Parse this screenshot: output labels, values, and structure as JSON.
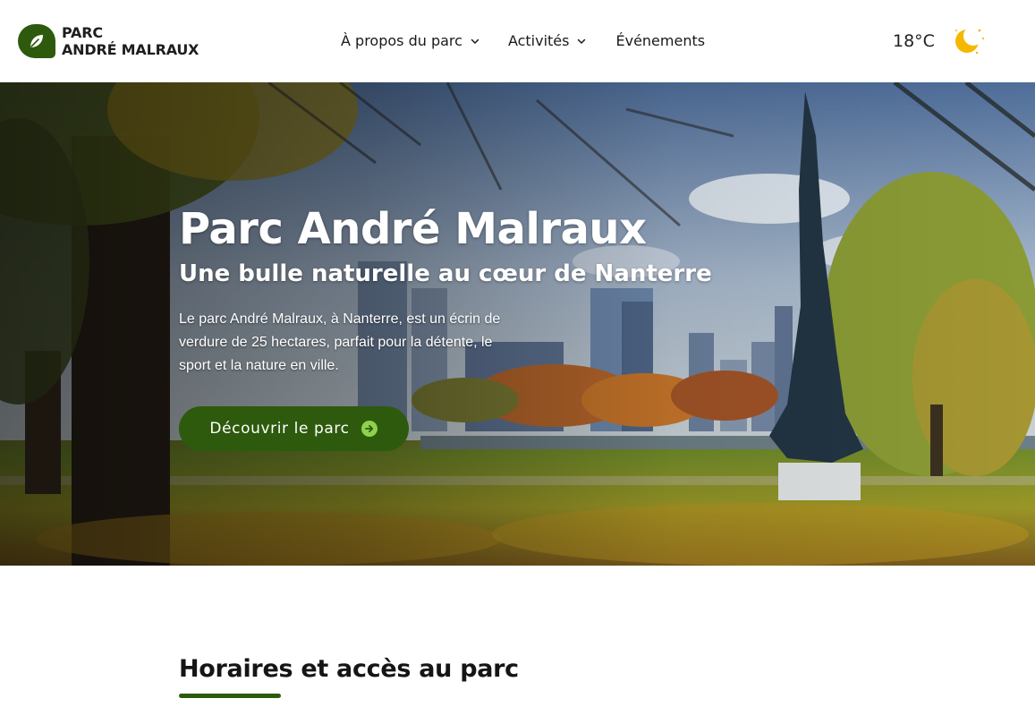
{
  "brand": {
    "line1": "PARC",
    "line2": "ANDRÉ MALRAUX",
    "accent_color": "#2d5a0c",
    "icon": "leaf-icon"
  },
  "nav": {
    "items": [
      {
        "label": "À propos du parc",
        "has_dropdown": true
      },
      {
        "label": "Activités",
        "has_dropdown": true
      },
      {
        "label": "Événements",
        "has_dropdown": false
      }
    ]
  },
  "weather": {
    "temperature": "18°C",
    "icon": "moon-icon",
    "icon_color": "#f5b800"
  },
  "hero": {
    "title": "Parc André Malraux",
    "subtitle": "Une bulle naturelle au cœur de Nanterre",
    "description": "Le parc André Malraux, à Nanterre, est un écrin de verdure de 25 hectares, parfait pour la détente, le sport et la nature en ville.",
    "cta_label": "Découvrir le parc",
    "cta_icon": "arrow-right-circle-icon"
  },
  "section": {
    "title": "Horaires et accès au parc"
  }
}
